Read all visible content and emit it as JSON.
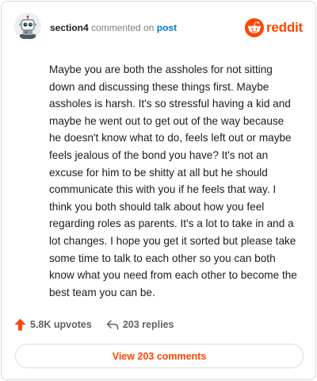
{
  "header": {
    "username": "section4",
    "action_text": "commented on",
    "post_link": "post",
    "brand_name": "reddit"
  },
  "comment": {
    "text": "Maybe you are both the assholes for not sitting down and discussing these things first. Maybe assholes is harsh. It's so stressful having a kid and maybe he went out to get out of the way because he doesn't know what to do, feels left out or maybe feels jealous of the bond you have? It's not an excuse for him to be shitty at all but he should communicate this with you if he feels that way. I think you both should talk about how you feel regarding roles as parents. It's a lot to take in and a lot changes. I hope you get it sorted but please take some time to talk to each other so you can both know what you need from each other to become the best team you can be."
  },
  "actions": {
    "upvotes": "5.8K upvotes",
    "replies": "203 replies"
  },
  "footer": {
    "view_comments": "View 203 comments"
  },
  "colors": {
    "brand": "#ff4500",
    "link": "#0079d3",
    "text": "#1c1c1c",
    "muted": "#616161"
  },
  "icons": {
    "avatar": "snoo-robot-avatar",
    "brand": "reddit-logo-icon",
    "upvote": "upvote-arrow-icon",
    "reply": "reply-arrow-icon"
  }
}
